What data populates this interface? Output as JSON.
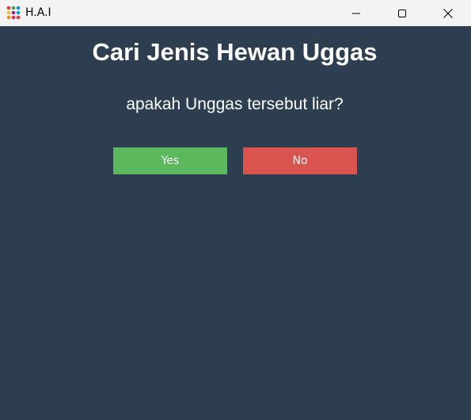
{
  "window": {
    "title": "H.A.I",
    "app_icon": "grid-dots-icon",
    "controls": {
      "minimize_icon": "minimize-icon",
      "maximize_icon": "maximize-icon",
      "close_icon": "close-icon"
    }
  },
  "main": {
    "heading": "Cari Jenis Hewan Uggas",
    "question": "apakah Unggas tersebut liar?",
    "yes_label": "Yes",
    "no_label": "No"
  },
  "colors": {
    "background": "#2c3e50",
    "titlebar": "#f3f3f3",
    "yes_button": "#5cb85c",
    "no_button": "#d9534f",
    "text": "#ffffff"
  }
}
